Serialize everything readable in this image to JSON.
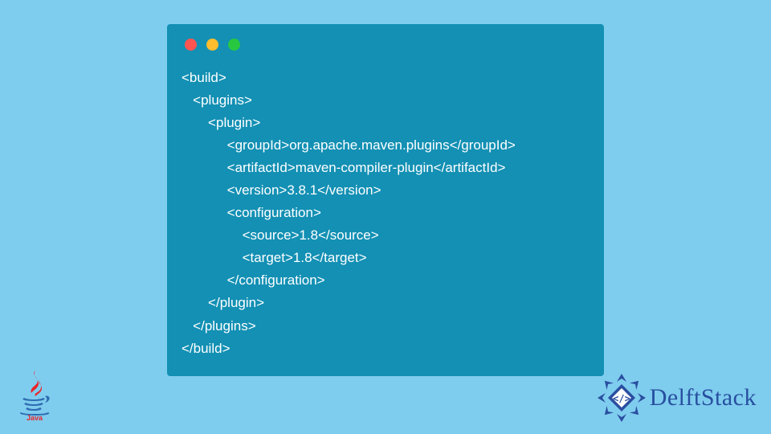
{
  "code": {
    "lines": [
      "<build>",
      "   <plugins>",
      "       <plugin>",
      "            <groupId>org.apache.maven.plugins</groupId>",
      "            <artifactId>maven-compiler-plugin</artifactId>",
      "            <version>3.8.1</version>",
      "            <configuration>",
      "                <source>1.8</source>",
      "                <target>1.8</target>",
      "            </configuration>",
      "       </plugin>",
      "   </plugins>",
      "</build>"
    ]
  },
  "brand": {
    "name": "DelftStack",
    "java_label": "Java"
  },
  "colors": {
    "page_bg": "#7fcdee",
    "window_bg": "#1390b4",
    "code_text": "#ffffff",
    "brand_text": "#274fa0",
    "dot_red": "#ff5450",
    "dot_yellow": "#fdbd2e",
    "dot_green": "#27c840"
  }
}
